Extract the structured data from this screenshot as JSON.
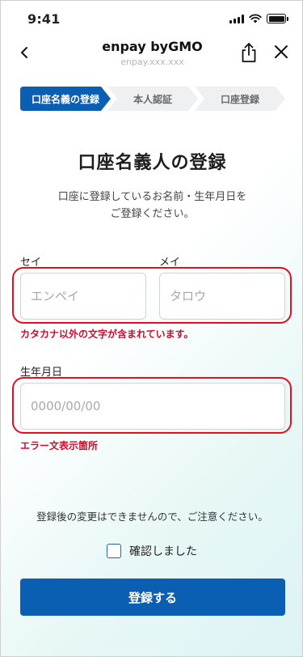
{
  "status_bar": {
    "time": "9:41"
  },
  "nav": {
    "title": "enpay byGMO",
    "subtitle": "enpay.xxx.xxx"
  },
  "stepper": {
    "steps": [
      {
        "label": "口座名義の登録",
        "active": true
      },
      {
        "label": "本人認証",
        "active": false
      },
      {
        "label": "口座登録",
        "active": false
      }
    ]
  },
  "page": {
    "title": "口座名義人の登録",
    "description_line1": "口座に登録しているお名前・生年月日を",
    "description_line2": "ご登録ください。"
  },
  "form": {
    "sei_label": "セイ",
    "sei_placeholder": "エンペイ",
    "mei_label": "メイ",
    "mei_placeholder": "タロウ",
    "name_error": "カタカナ以外の文字が含まれています。",
    "birth_label": "生年月日",
    "birth_placeholder": "0000/00/00",
    "birth_error": "エラー文表示箇所"
  },
  "footer": {
    "notice": "登録後の変更はできませんので、ご注意ください。",
    "confirm_label": "確認しました",
    "confirm_checked": false,
    "submit_label": "登録する"
  },
  "colors": {
    "primary": "#0a5fb3",
    "error": "#c8102e",
    "step_inactive": "#eef0f2"
  }
}
